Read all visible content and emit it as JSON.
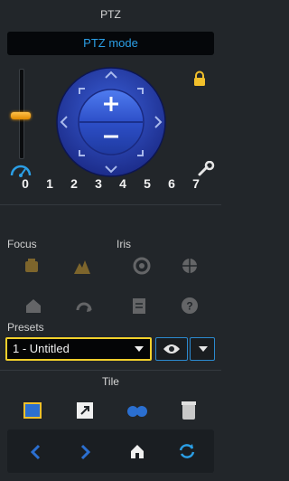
{
  "ptz": {
    "title": "PTZ",
    "mode_label": "PTZ mode",
    "zoom_slider_level_pct": 58,
    "presets": [
      "0",
      "1",
      "2",
      "3",
      "4",
      "5",
      "6",
      "7"
    ],
    "accent_color": "#2b9fe6",
    "slider_color": "#ffa000",
    "icons": {
      "speed": "speedometer-icon",
      "lock": "padlock-icon",
      "settings": "wrench-icon",
      "zoom_in": "plus-icon",
      "zoom_out": "minus-icon"
    }
  },
  "controls": {
    "focus_label": "Focus",
    "iris_label": "Iris",
    "presets_label": "Presets",
    "selected_preset": "1 - Untitled",
    "highlight_color": "#f2d02b"
  },
  "tile": {
    "title": "Tile"
  }
}
